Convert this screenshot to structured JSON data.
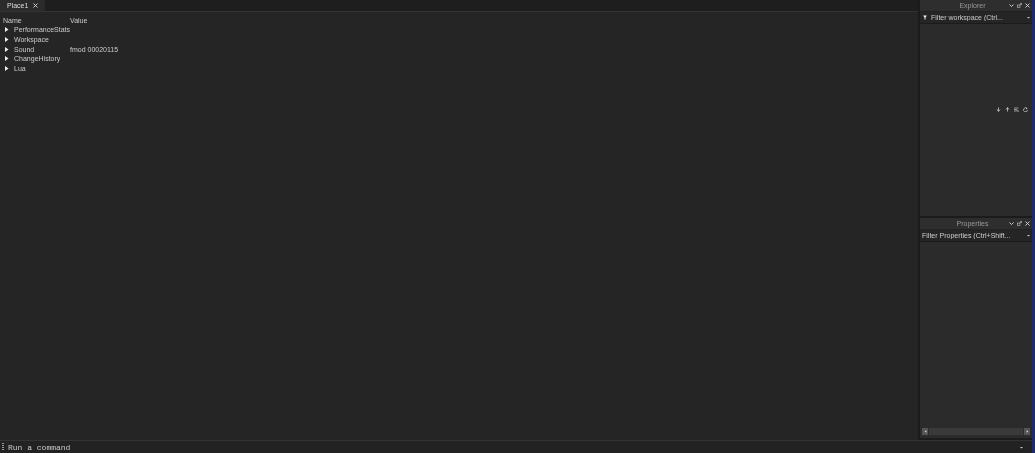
{
  "tabs": [
    {
      "label": "Place1",
      "selected": true
    }
  ],
  "tree": {
    "columns": [
      "Name",
      "Value"
    ],
    "rows": [
      {
        "name": "PerformanceStats",
        "value": "",
        "expanded": false
      },
      {
        "name": "Workspace",
        "value": "",
        "expanded": false
      },
      {
        "name": "Sound",
        "value": "fmod 00020115",
        "expanded": false
      },
      {
        "name": "ChangeHistory",
        "value": "",
        "expanded": false
      },
      {
        "name": "Lua",
        "value": "",
        "expanded": false
      }
    ]
  },
  "explorer": {
    "title": "Explorer",
    "filter": {
      "placeholder": "Filter workspace (Ctrl..."
    }
  },
  "properties": {
    "title": "Properties",
    "filter": {
      "placeholder": "Filter Properties (Ctrl+Shift..."
    }
  },
  "command_bar": {
    "placeholder": "Run a command"
  }
}
